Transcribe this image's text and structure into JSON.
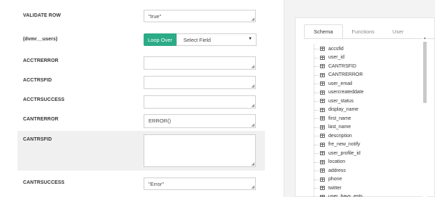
{
  "fields": {
    "validate_row": {
      "label": "VALIDATE ROW",
      "value": "\"true\""
    },
    "dvmr_users": {
      "label": "(dvmr__users)",
      "loop_button": "Loop Over",
      "select_value": "Select Field"
    },
    "acctrerror": {
      "label": "ACCTRERROR",
      "value": ""
    },
    "acctrsfid": {
      "label": "ACCTRSFID",
      "value": ""
    },
    "acctrsuccess": {
      "label": "ACCTRSUCCESS",
      "value": ""
    },
    "cantrerror": {
      "label": "CANTRERROR",
      "value": "ERROR()"
    },
    "cantrsfid": {
      "label": "CANTRSFID",
      "value": ""
    },
    "cantrsuccess": {
      "label": "CANTRSUCCESS",
      "value": "\"Error\""
    }
  },
  "tabs": [
    {
      "label": "Schema",
      "active": true
    },
    {
      "label": "Functions",
      "active": false
    },
    {
      "label": "User",
      "active": false
    }
  ],
  "schema": [
    "accsfid",
    "user_id",
    "CANTRSFID",
    "CANTRERROR",
    "user_email",
    "usercreateddate",
    "user_status",
    "display_name",
    "first_name",
    "last_name",
    "description",
    "fre_new_notify",
    "user_profile_id",
    "location",
    "address",
    "phone",
    "twitter",
    "user_bays_ests"
  ],
  "colors": {
    "accent": "#2bab86",
    "highlight_row": "#f0f0f0"
  }
}
